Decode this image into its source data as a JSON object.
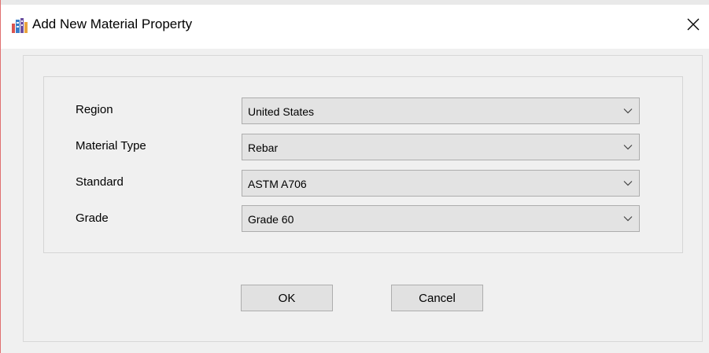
{
  "window": {
    "title": "Add New Material Property"
  },
  "fields": [
    {
      "label": "Region",
      "value": "United States"
    },
    {
      "label": "Material Type",
      "value": "Rebar"
    },
    {
      "label": "Standard",
      "value": "ASTM A706"
    },
    {
      "label": "Grade",
      "value": "Grade 60"
    }
  ],
  "buttons": {
    "ok": "OK",
    "cancel": "Cancel"
  },
  "icons": {
    "app": "material-app-icon",
    "close": "close-icon",
    "dropdown": "chevron-down-icon"
  },
  "colors": {
    "window_bg": "#f0f0f0",
    "titlebar_bg": "#ffffff",
    "combo_bg": "#e3e3e3",
    "button_bg": "#e1e1e1",
    "border": "#adadad",
    "window_edge": "#e07070"
  }
}
